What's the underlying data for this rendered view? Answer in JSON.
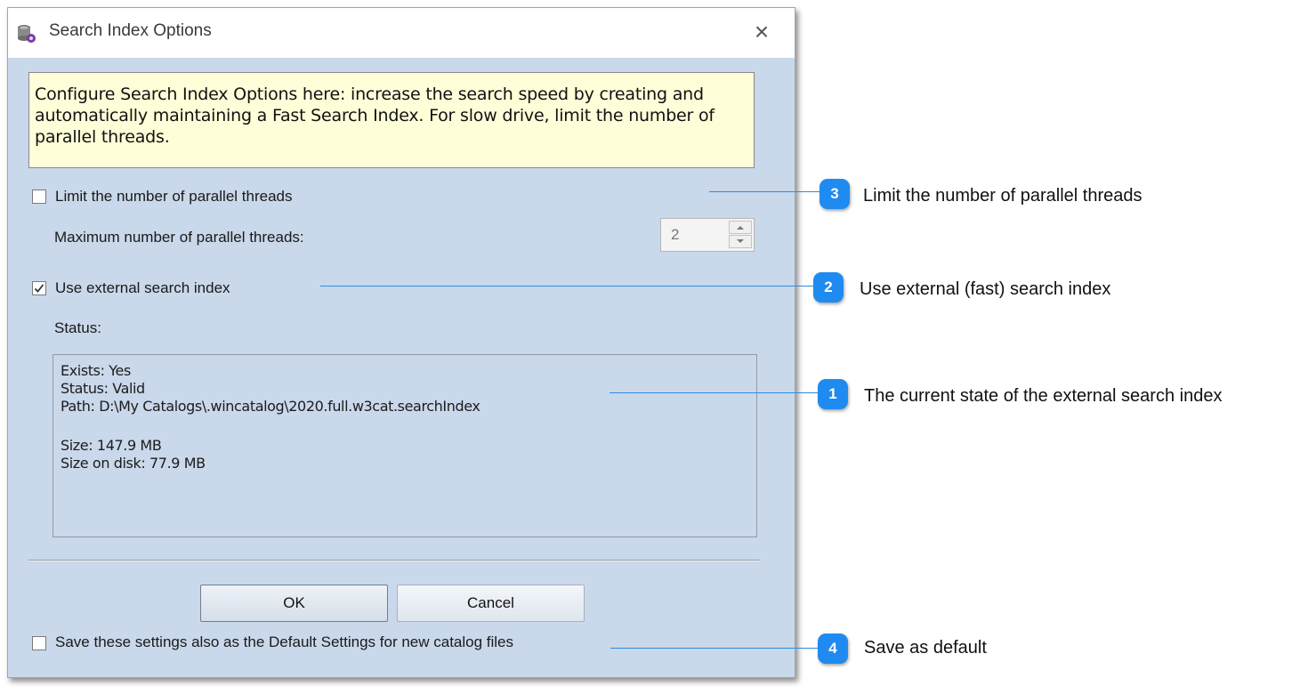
{
  "window": {
    "title": "Search Index Options",
    "close_glyph": "×"
  },
  "info": {
    "text": "Configure Search Index Options here: increase the search speed by creating and automatically maintaining a Fast Search Index. For slow drive, limit the number of parallel threads."
  },
  "threads": {
    "limit_label": "Limit the number of parallel threads",
    "limit_checked": false,
    "max_label": "Maximum number of parallel threads:",
    "max_value": "2"
  },
  "external_index": {
    "label": "Use external search index",
    "checked": true,
    "status_label": "Status:",
    "status_lines": [
      "Exists: Yes",
      "Status: Valid",
      "Path: D:\\My Catalogs\\.wincatalog\\2020.full.w3cat.searchIndex",
      "",
      "Size: 147.9 MB",
      "Size on disk: 77.9 MB"
    ]
  },
  "buttons": {
    "ok": "OK",
    "cancel": "Cancel"
  },
  "default_settings": {
    "label": "Save these settings also as the Default Settings for new catalog files",
    "checked": false
  },
  "callouts": [
    {
      "number": "3",
      "text": "Limit the number of parallel threads"
    },
    {
      "number": "2",
      "text": "Use external (fast) search index"
    },
    {
      "number": "1",
      "text": "The current state of the external search index"
    },
    {
      "number": "4",
      "text": "Save as default"
    }
  ],
  "colors": {
    "dialog_bg": "#c9d8ea",
    "info_bg": "#fefed9",
    "badge": "#1f8bf0",
    "callout_line": "#2f8be0"
  }
}
